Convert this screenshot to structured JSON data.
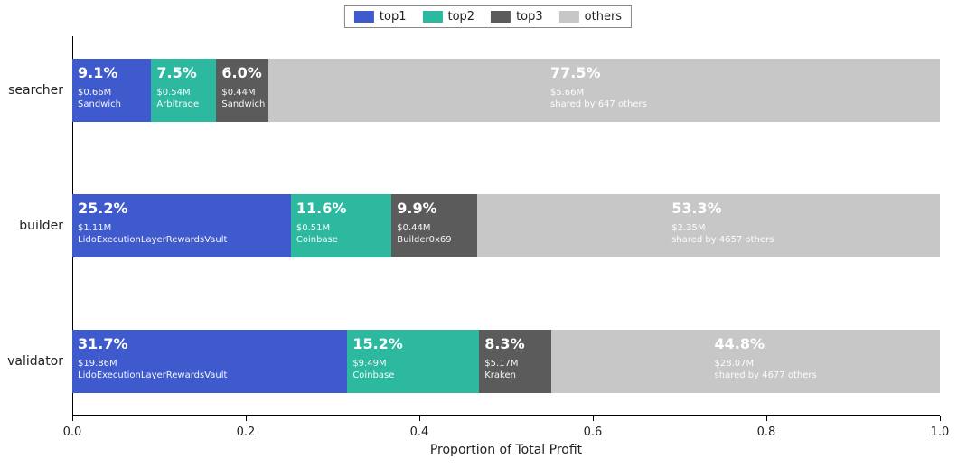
{
  "chart_data": {
    "type": "bar",
    "orientation": "horizontal-stacked",
    "xlabel": "Proportion of Total Profit",
    "xlim": [
      0.0,
      1.0
    ],
    "xticks": [
      0.0,
      0.2,
      0.4,
      0.6,
      0.8,
      1.0
    ],
    "categories": [
      "searcher",
      "builder",
      "validator"
    ],
    "series": [
      {
        "name": "top1",
        "color": "#3f5acc",
        "values": [
          0.091,
          0.252,
          0.317
        ]
      },
      {
        "name": "top2",
        "color": "#2cb9a0",
        "values": [
          0.075,
          0.116,
          0.152
        ]
      },
      {
        "name": "top3",
        "color": "#5b5b5b",
        "values": [
          0.06,
          0.099,
          0.083
        ]
      },
      {
        "name": "others",
        "color": "#c7c7c7",
        "values": [
          0.775,
          0.533,
          0.448
        ]
      }
    ],
    "annotations": {
      "searcher": {
        "top1": {
          "pct": "9.1%",
          "amount": "$0.66M",
          "label": "Sandwich"
        },
        "top2": {
          "pct": "7.5%",
          "amount": "$0.54M",
          "label": "Arbitrage"
        },
        "top3": {
          "pct": "6.0%",
          "amount": "$0.44M",
          "label": "Sandwich"
        },
        "others": {
          "pct": "77.5%",
          "amount": "$5.66M",
          "label": "shared by 647 others"
        }
      },
      "builder": {
        "top1": {
          "pct": "25.2%",
          "amount": "$1.11M",
          "label": "LidoExecutionLayerRewardsVault"
        },
        "top2": {
          "pct": "11.6%",
          "amount": "$0.51M",
          "label": "Coinbase"
        },
        "top3": {
          "pct": "9.9%",
          "amount": "$0.44M",
          "label": "Builder0x69"
        },
        "others": {
          "pct": "53.3%",
          "amount": "$2.35M",
          "label": "shared by 4657 others"
        }
      },
      "validator": {
        "top1": {
          "pct": "31.7%",
          "amount": "$19.86M",
          "label": "LidoExecutionLayerRewardsVault"
        },
        "top2": {
          "pct": "15.2%",
          "amount": "$9.49M",
          "label": "Coinbase"
        },
        "top3": {
          "pct": "8.3%",
          "amount": "$5.17M",
          "label": "Kraken"
        },
        "others": {
          "pct": "44.8%",
          "amount": "$28.07M",
          "label": "shared by 4677 others"
        }
      }
    }
  },
  "legend": {
    "top1": "top1",
    "top2": "top2",
    "top3": "top3",
    "others": "others"
  },
  "tick_labels": {
    "t0": "0.0",
    "t1": "0.2",
    "t2": "0.4",
    "t3": "0.6",
    "t4": "0.8",
    "t5": "1.0"
  }
}
